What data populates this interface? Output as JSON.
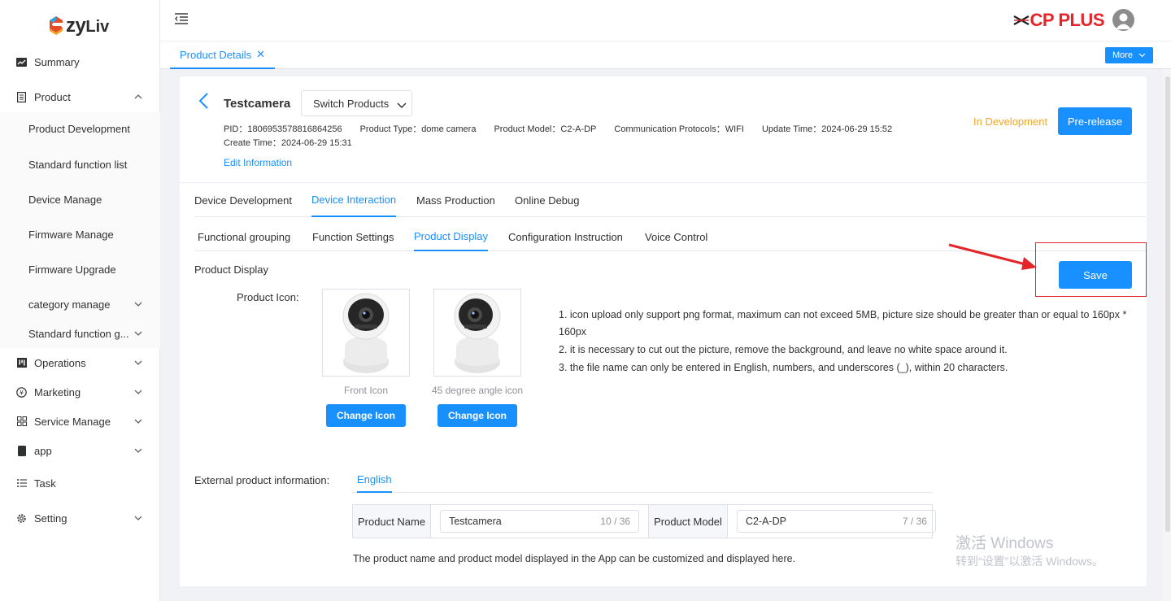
{
  "brand": {
    "logo_text": "ezyLiv",
    "logo_word": "zy",
    "logo_suffix": "Liv",
    "company": "CP PLUS"
  },
  "sidebar": {
    "items": [
      {
        "label": "Summary",
        "icon": "chart-icon"
      },
      {
        "label": "Product",
        "icon": "doc-icon",
        "expanded": true
      },
      {
        "label": "Operations",
        "icon": "operations-icon"
      },
      {
        "label": "Marketing",
        "icon": "marketing-icon"
      },
      {
        "label": "Service Manage",
        "icon": "grid-icon"
      },
      {
        "label": "app",
        "icon": "app-icon"
      },
      {
        "label": "Task",
        "icon": "list-icon"
      },
      {
        "label": "Setting",
        "icon": "gear-icon"
      }
    ],
    "product_sub": [
      "Product Development",
      "Standard function list",
      "Device Manage",
      "Firmware Manage",
      "Firmware Upgrade",
      "category manage",
      "Standard function g..."
    ]
  },
  "tabstrip": {
    "active_tab": "Product Details",
    "more": "More"
  },
  "product": {
    "name": "Testcamera",
    "switch_label": "Switch Products",
    "pid": "PID：1806953578816864256",
    "type": "Product Type：dome camera",
    "model": "Product Model：C2-A-DP",
    "protocols": "Communication Protocols：WIFI",
    "update_time": "Update Time：2024-06-29 15:52",
    "create_time": "Create Time：2024-06-29 15:31",
    "edit_link": "Edit Information",
    "status": "In Development",
    "prerelease": "Pre-release"
  },
  "tabs_primary": [
    "Device Development",
    "Device Interaction",
    "Mass Production",
    "Online Debug"
  ],
  "tabs_secondary": [
    "Functional grouping",
    "Function Settings",
    "Product Display",
    "Configuration Instruction",
    "Voice Control"
  ],
  "display": {
    "section_title": "Product Display",
    "save": "Save",
    "icon_label": "Product Icon:",
    "front_caption": "Front Icon",
    "angle_caption": "45 degree angle icon",
    "change_icon": "Change Icon",
    "tips": [
      "1. icon upload only support png format, maximum can not exceed 5MB, picture size should be greater than or equal to 160px * 160px",
      "2. it is necessary to cut out the picture, remove the background, and leave no white space around it.",
      "3. the file name can only be entered in English, numbers, and underscores (_), within 20 characters."
    ]
  },
  "external": {
    "label": "External product information:",
    "lang_tab": "English",
    "name_label": "Product Name",
    "name_value": "Testcamera",
    "name_count": "10 / 36",
    "model_label": "Product Model",
    "model_value": "C2-A-DP",
    "model_count": "7 / 36",
    "note": "The product name and product model displayed in the App can be customized and displayed here."
  },
  "watermark": {
    "line1": "激活 Windows",
    "line2": "转到“设置”以激活 Windows。"
  },
  "colors": {
    "primary": "#1890ff",
    "status_orange": "#f5a623",
    "brand_red": "#e4262b"
  }
}
